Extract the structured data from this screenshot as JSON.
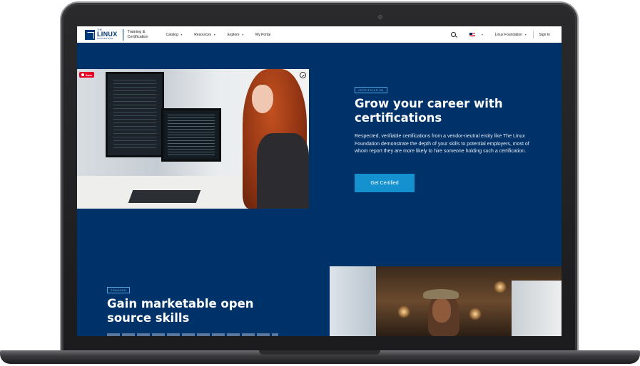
{
  "header": {
    "logo_the": "THE",
    "logo_linux": "LINUX",
    "logo_foundation": "FOUNDATION",
    "subtitle_line1": "Training &",
    "subtitle_line2": "Certification",
    "nav": [
      {
        "label": "Catalog",
        "has_caret": true
      },
      {
        "label": "Resources",
        "has_caret": true
      },
      {
        "label": "Explore",
        "has_caret": true
      },
      {
        "label": "My Portal",
        "has_caret": false
      }
    ],
    "lf_menu": "Linux Foundation",
    "signin": "Sign In",
    "icons": {
      "search": "search-icon",
      "flag": "us-flag-icon"
    }
  },
  "hero": {
    "pin_save": "Save",
    "badge": "CERTIFICATION",
    "title": "Grow your career with certifications",
    "text": "Respected, verifiable certifications from a vendor-neutral entity like The Linux Foundation demonstrate the depth of your skills to potential employers, most of whom report they are more likely to hire someone holding such a certification.",
    "cta": "Get Certified"
  },
  "training": {
    "badge": "TRAINING",
    "title": "Gain marketable open source skills"
  },
  "colors": {
    "page_bg": "#00326a",
    "accent": "#1591cf",
    "badge_border": "#4aa3df",
    "brand": "#003778"
  }
}
